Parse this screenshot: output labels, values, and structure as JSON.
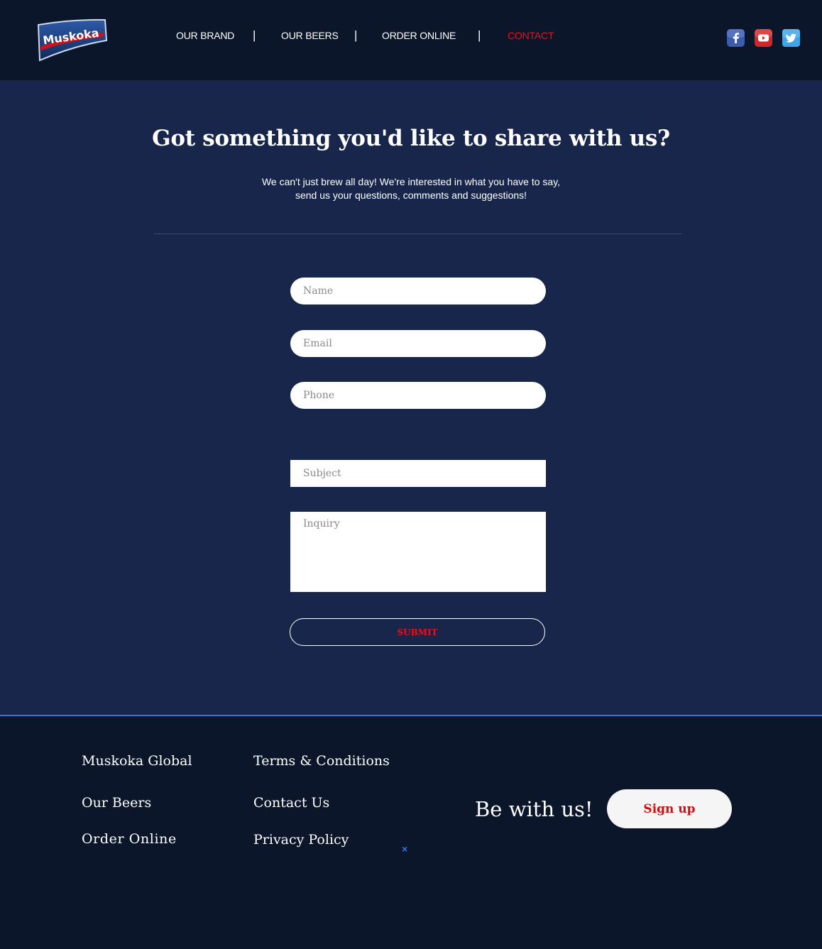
{
  "brand": {
    "logo_text": "Muskoka"
  },
  "nav": {
    "items": [
      {
        "label": "OUR BRAND"
      },
      {
        "label": "OUR BEERS"
      },
      {
        "label": "ORDER ONLINE"
      },
      {
        "label": "CONTACT",
        "active": true
      }
    ],
    "separator": "|"
  },
  "social": [
    {
      "icon": "facebook-icon",
      "color": "#3b5da9"
    },
    {
      "icon": "youtube-icon",
      "color": "#d42626"
    },
    {
      "icon": "twitter-icon",
      "color": "#3fa3e6"
    }
  ],
  "main": {
    "title": "Got something you'd like to share with us?",
    "subtitle_line1": "We can't just brew all day!  We're interested in what you have to say,",
    "subtitle_line2": "send us your questions, comments and suggestions!"
  },
  "form": {
    "name_placeholder": "Name",
    "email_placeholder": "Email",
    "phone_placeholder": "Phone",
    "subject_placeholder": "Subject",
    "inquiry_placeholder": "Inquiry",
    "submit_label": "SUBMIT"
  },
  "footer": {
    "col1": [
      "Muskoka Global",
      "Our Beers",
      "Order Online"
    ],
    "col2": [
      "Terms & Conditions",
      "Contact Us",
      "Privacy Policy"
    ],
    "cta_text": "Be with us!",
    "signup_label": "Sign up",
    "close_glyph": "×"
  },
  "colors": {
    "header_bg": "#0c162b",
    "main_bg": "#17264a",
    "accent_red": "#e8101a",
    "footer_line": "#3a6fe0"
  }
}
